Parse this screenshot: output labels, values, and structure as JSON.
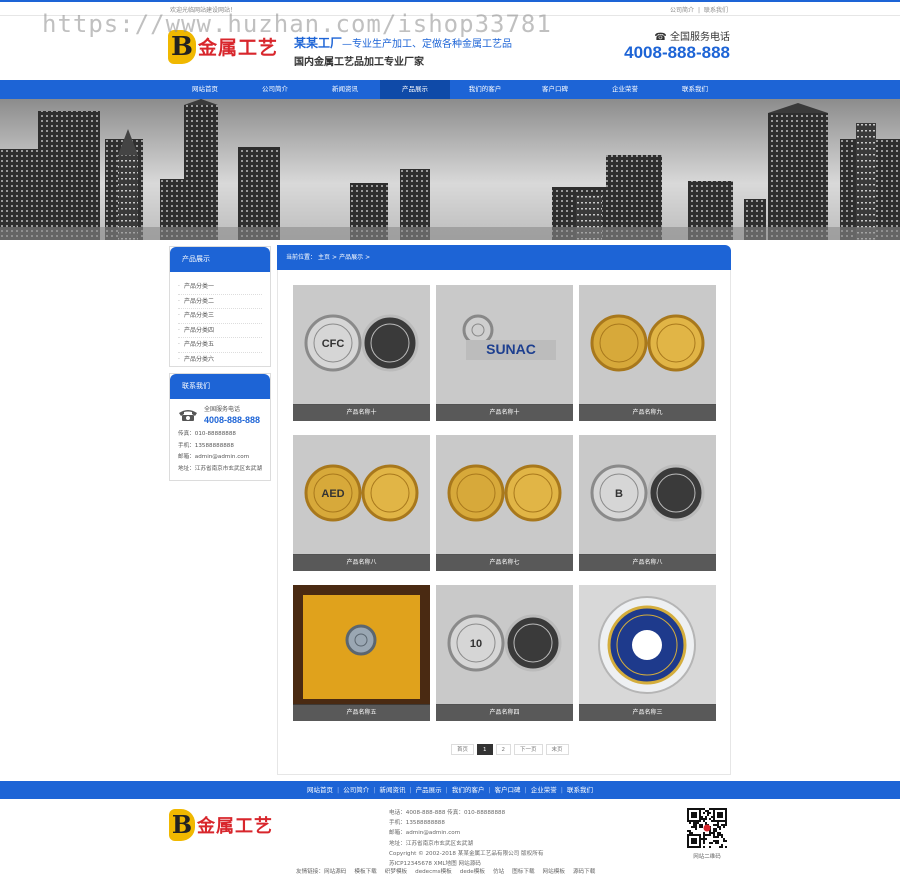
{
  "topbar": {
    "welcome": "欢迎光临网站建设网站！",
    "link1": "公司简介",
    "sep": "|",
    "link2": "联系我们"
  },
  "watermark": "https://www.huzhan.com/ishop33781",
  "header": {
    "logo_letter": "B",
    "logo_text": "金属工艺",
    "slogan_strong": "某某工厂",
    "slogan_rest": "—专业生产加工、定做各种金属工艺品",
    "slogan_line2": "国内金属工艺品加工专业厂家",
    "hotline_label": "全国服务电话",
    "hotline_number": "4008-888-888"
  },
  "nav": [
    "网站首页",
    "公司简介",
    "新闻资讯",
    "产品展示",
    "我们的客户",
    "客户口碑",
    "企业荣誉",
    "联系我们"
  ],
  "nav_active_index": 3,
  "sidebar": {
    "category_title": "产品展示",
    "categories": [
      "产品分类一",
      "产品分类二",
      "产品分类三",
      "产品分类四",
      "产品分类五",
      "产品分类六"
    ],
    "contact_title": "联系我们",
    "phone_label": "全国服务电话",
    "phone_number": "4008-888-888",
    "contact_lines": [
      "传真：010-88888888",
      "手机：13588888888",
      "邮箱：admin@admin.com",
      "地址：江苏省南京市玄武区玄武湖"
    ]
  },
  "breadcrumb": {
    "label": "当前位置：",
    "home": "主页",
    "sep": ">",
    "current": "产品展示",
    "trail": ">"
  },
  "products": [
    {
      "caption": "产品名称十",
      "theme": "silver-pair",
      "mark": "CFC"
    },
    {
      "caption": "产品名称十",
      "theme": "pin",
      "mark": "SUNAC"
    },
    {
      "caption": "产品名称九",
      "theme": "gold-pair",
      "mark": ""
    },
    {
      "caption": "产品名称八",
      "theme": "gold-pair",
      "mark": "AED"
    },
    {
      "caption": "产品名称七",
      "theme": "gold-pair",
      "mark": ""
    },
    {
      "caption": "产品名称八",
      "theme": "silver-pair",
      "mark": "B"
    },
    {
      "caption": "产品名称五",
      "theme": "box",
      "mark": ""
    },
    {
      "caption": "产品名称四",
      "theme": "silver-pair",
      "mark": "10"
    },
    {
      "caption": "产品名称三",
      "theme": "blue-coin",
      "mark": ""
    }
  ],
  "pagination": {
    "first": "首页",
    "pages": [
      "1",
      "2"
    ],
    "current": "1",
    "next": "下一页",
    "last": "末页"
  },
  "footer": {
    "nav": [
      "网站首页",
      "公司简介",
      "新闻资讯",
      "产品展示",
      "我们的客户",
      "客户口碑",
      "企业荣誉",
      "联系我们"
    ],
    "sep": "|",
    "info_lines": [
      "电话：4008-888-888 传真：010-88888888",
      "手机：13588888888",
      "邮箱：admin@admin.com",
      "地址：江苏省南京市玄武区玄武湖",
      "Copyright © 2002-2018 某某金属工艺品有限公司 版权所有",
      "苏ICP12345678 XML地图 网站源码"
    ],
    "qr_caption": "网站二维码",
    "links": [
      "友情链接：网站源码",
      "模板下载",
      "织梦模板",
      "dedecms模板",
      "dede模板",
      "仿站",
      "图标下载",
      "网站模板",
      "源码下载"
    ]
  },
  "colors": {
    "brand_blue": "#1d64d6",
    "nav_active": "#0f4aa8",
    "logo_gold": "#f0b800",
    "logo_red": "#d8262c"
  }
}
